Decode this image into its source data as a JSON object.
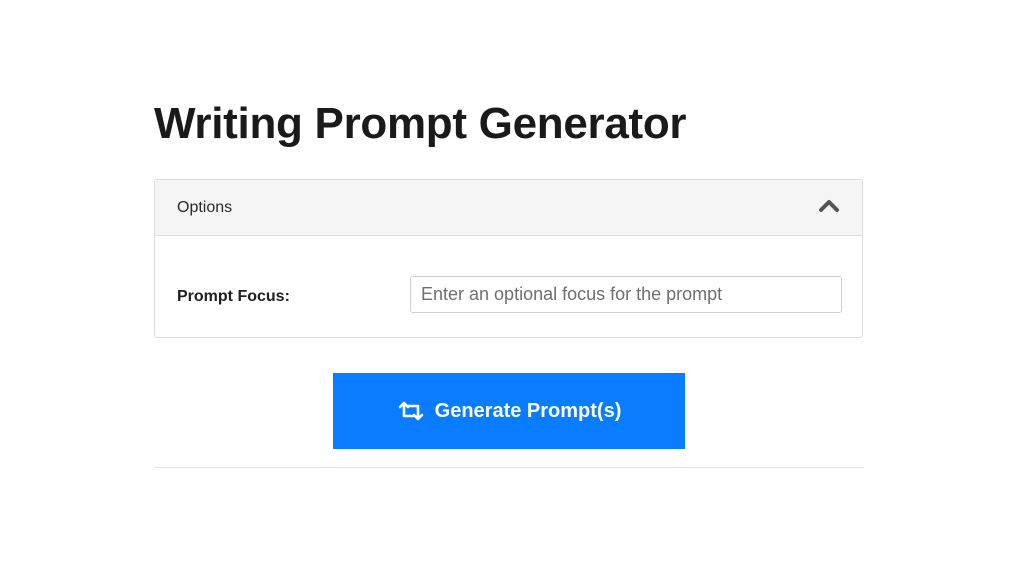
{
  "page": {
    "title": "Writing Prompt Generator"
  },
  "options": {
    "header_label": "Options",
    "collapse_icon": "chevron-up-icon",
    "prompt_focus": {
      "label": "Prompt Focus:",
      "value": "",
      "placeholder": "Enter an optional focus for the prompt"
    }
  },
  "generate_button": {
    "label": "Generate Prompt(s)",
    "icon": "retweet-icon",
    "color": "#0a7cff"
  }
}
